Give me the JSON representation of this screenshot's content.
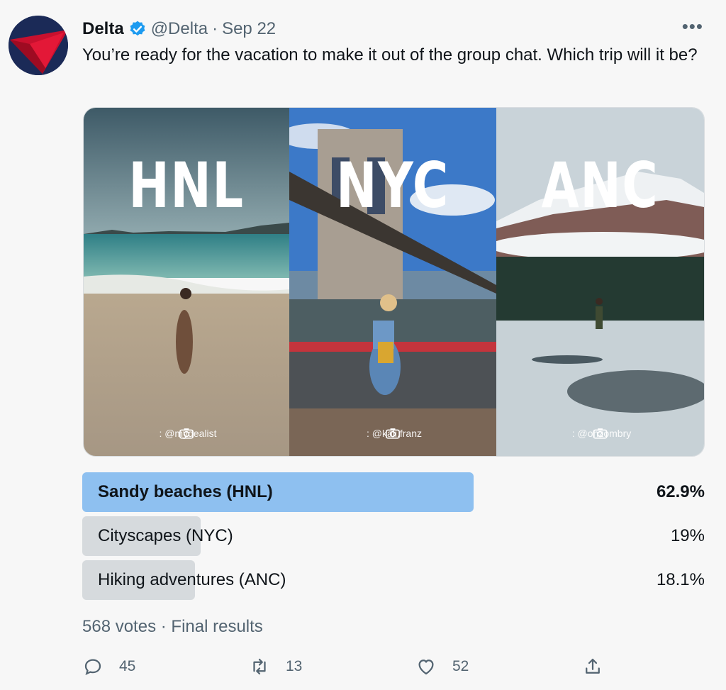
{
  "tweet": {
    "author_name": "Delta",
    "handle": "@Delta",
    "separator": "·",
    "date": "Sep 22",
    "more_label": "•••",
    "text": "You’re ready for the vacation to make it out of the group chat. Which trip will it be?"
  },
  "media": {
    "panels": [
      {
        "code": "HNL",
        "credit": ": @mydealist"
      },
      {
        "code": "NYC",
        "credit": ": @kali.franz"
      },
      {
        "code": "ANC",
        "credit": ": @ohzombry"
      }
    ]
  },
  "poll": {
    "options": [
      {
        "label": "Sandy beaches (HNL)",
        "percent_text": "62.9%",
        "percent": 62.9,
        "winner": true
      },
      {
        "label": "Cityscapes (NYC)",
        "percent_text": "19%",
        "percent": 19,
        "winner": false
      },
      {
        "label": "Hiking adventures (ANC)",
        "percent_text": "18.1%",
        "percent": 18.1,
        "winner": false
      }
    ],
    "votes": "568 votes",
    "separator": "·",
    "status": "Final results"
  },
  "actions": {
    "replies": "45",
    "retweets": "13",
    "likes": "52"
  },
  "colors": {
    "winner_bar": "#8ec0f0",
    "other_bar": "#d6dadd",
    "verified": "#1d9bf0",
    "avatar_bg": "#1b2a57",
    "avatar_red": "#c8102e"
  },
  "icons": [
    "verified-badge-icon",
    "more-icon",
    "camera-icon",
    "reply-icon",
    "retweet-icon",
    "like-icon",
    "share-icon"
  ]
}
